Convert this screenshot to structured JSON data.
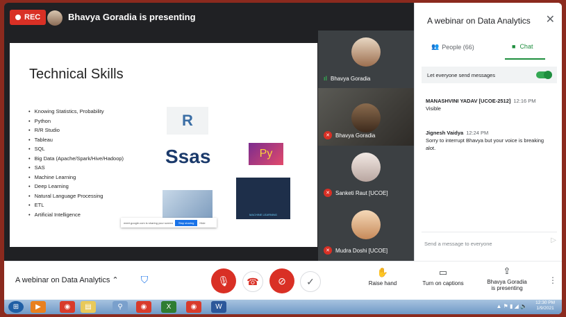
{
  "topbar": {
    "rec_label": "REC",
    "presenter_text": "Bhavya Goradia is presenting"
  },
  "slide": {
    "title": "Technical Skills",
    "skills": [
      "Knowing Statistics, Probability",
      "Python",
      "R/R Studio",
      "Tableau",
      "SQL",
      "Big Data (Apache/Spark/Hive/Hadoop)",
      "SAS",
      "Machine Learning",
      "Deep Learning",
      "Natural Language Processing",
      "ETL",
      "Artificial Intelligence"
    ],
    "sas_logo": "Ssas",
    "r_logo": "R",
    "python_logo": "Py",
    "ml_caption": "MACHINE LEARNING",
    "share_bar_text": "meet.google.com is sharing your screen",
    "share_stop_label": "Stop sharing",
    "share_hide_label": "Hide"
  },
  "participants": [
    {
      "name": "Bhavya Goradia",
      "mic": "speaking"
    },
    {
      "name": "Bhavya Goradia",
      "mic": "muted"
    },
    {
      "name": "Sanketi Raut [UCOE]",
      "mic": "muted"
    },
    {
      "name": "Mudra Doshi [UCOE]",
      "mic": "muted"
    }
  ],
  "panel": {
    "title": "A webinar on Data Analytics",
    "close_icon": "close-icon",
    "tab_people": "People (66)",
    "tab_chat": "Chat",
    "allow_messages": "Let everyone send messages",
    "messages": [
      {
        "sender": "MANASHVINI YADAV [UCOE-2512]",
        "time": "12:16 PM",
        "text": "Visible"
      },
      {
        "sender": "Jignesh Vaidya",
        "time": "12:24 PM",
        "text": "Sorry to interrupt Bhavya but your voice is breaking alot."
      }
    ],
    "send_placeholder": "Send a message to everyone"
  },
  "bottombar": {
    "meeting_title": "A webinar on Data Analytics",
    "raise_hand": "Raise hand",
    "captions": "Turn on captions",
    "presenting_line1": "Bhavya Goradia",
    "presenting_line2": "is presenting"
  },
  "taskbar": {
    "time": "12:30 PM",
    "date": "1/9/2021"
  },
  "colors": {
    "accent_green": "#1e8e3e",
    "danger_red": "#d93025",
    "frame_border": "#8b2a1e"
  }
}
